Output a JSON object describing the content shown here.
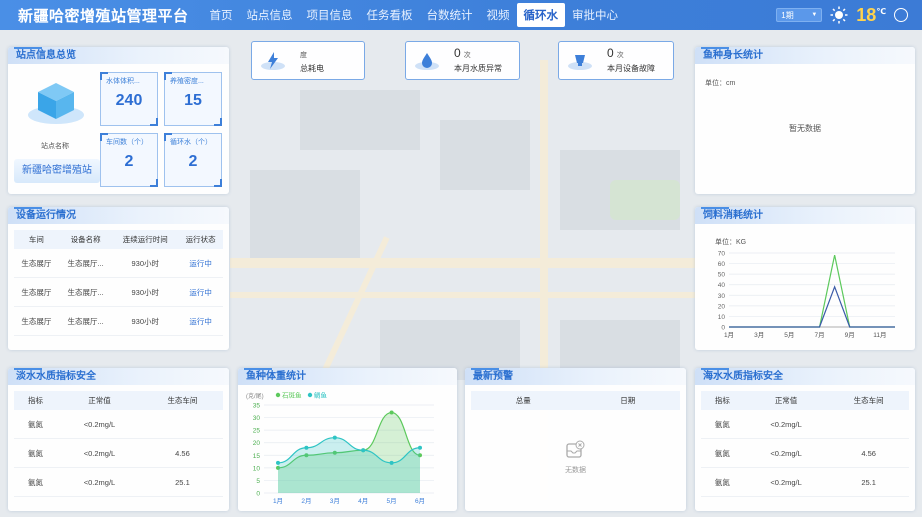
{
  "header": {
    "title": "新疆哈密增殖站管理平台",
    "nav": [
      "首页",
      "站点信息",
      "项目信息",
      "任务看板",
      "台数统计",
      "视频",
      "循环水",
      "审批中心"
    ],
    "active_index": 6,
    "period_select": "1期",
    "temperature": "18",
    "temp_unit": "℃"
  },
  "stats": [
    {
      "value": "",
      "unit": "度",
      "label": "总耗电",
      "icon": "power-icon"
    },
    {
      "value": "0",
      "unit": "次",
      "label": "本月水质异常",
      "icon": "water-quality-icon"
    },
    {
      "value": "0",
      "unit": "次",
      "label": "本月设备故障",
      "icon": "device-fault-icon"
    }
  ],
  "site": {
    "title": "站点信息总览",
    "name_label": "站点名称",
    "name": "新疆哈密增殖站",
    "cards": [
      {
        "label": "水体体积...",
        "value": "240"
      },
      {
        "label": "养殖密度...",
        "value": "15"
      },
      {
        "label": "车间数（个）",
        "value": "2"
      },
      {
        "label": "循环水（个）",
        "value": "2"
      }
    ]
  },
  "equipment": {
    "title": "设备运行情况",
    "columns": [
      "车间",
      "设备名称",
      "连续运行时间",
      "运行状态"
    ],
    "rows": [
      [
        "生态展厅",
        "生态展厅...",
        "930小时",
        "运行中"
      ],
      [
        "生态展厅",
        "生态展厅...",
        "930小时",
        "运行中"
      ],
      [
        "生态展厅",
        "生态展厅...",
        "930小时",
        "运行中"
      ]
    ]
  },
  "fish_length": {
    "title": "鱼种身长统计",
    "unit_label": "单位：cm",
    "empty_text": "暂无数据"
  },
  "feed": {
    "title": "饲料消耗统计",
    "unit_label": "单位：KG"
  },
  "fresh_water": {
    "title": "淡水水质指标安全",
    "columns": [
      "指标",
      "正常值",
      "生态车间"
    ],
    "rows": [
      [
        "氨氮",
        "<0.2mg/L",
        ""
      ],
      [
        "氨氮",
        "<0.2mg/L",
        "4.56"
      ],
      [
        "氨氮",
        "<0.2mg/L",
        "25.1"
      ]
    ]
  },
  "fish_weight": {
    "title": "鱼种体重统计"
  },
  "warning": {
    "title": "最新预警",
    "columns": [
      "总量",
      "日期"
    ],
    "empty_text": "无数据"
  },
  "sea_water": {
    "title": "海水水质指标安全",
    "columns": [
      "指标",
      "正常值",
      "生态车间"
    ],
    "rows": [
      [
        "氨氮",
        "<0.2mg/L",
        ""
      ],
      [
        "氨氮",
        "<0.2mg/L",
        "4.56"
      ],
      [
        "氨氮",
        "<0.2mg/L",
        "25.1"
      ]
    ]
  },
  "colors": {
    "accent": "#3d7fd9",
    "green": "#5cc95c",
    "teal": "#2ec4c4",
    "navy": "#3a5aa8"
  },
  "chart_data": [
    {
      "type": "line",
      "title": "饲料消耗统计",
      "ylabel": "单位：KG",
      "x": [
        "1月",
        "2月",
        "3月",
        "4月",
        "5月",
        "6月",
        "7月",
        "8月",
        "9月",
        "10月",
        "11月",
        "12月"
      ],
      "xticks": [
        "1月",
        "3月",
        "5月",
        "7月",
        "9月",
        "11月"
      ],
      "ylim": [
        0,
        70
      ],
      "yticks": [
        0,
        10,
        20,
        30,
        40,
        50,
        60,
        70
      ],
      "series": [
        {
          "values": [
            0,
            0,
            0,
            0,
            0,
            0,
            0,
            68,
            0,
            0,
            0,
            0
          ],
          "color": "#5cc95c"
        },
        {
          "values": [
            0,
            0,
            0,
            0,
            0,
            0,
            0,
            38,
            0,
            0,
            0,
            0
          ],
          "color": "#3a5aa8"
        }
      ],
      "grid": true
    },
    {
      "type": "area",
      "title": "鱼种体重统计",
      "ylabel": "(克/尾)",
      "x": [
        "1月",
        "2月",
        "3月",
        "4月",
        "5月",
        "6月"
      ],
      "ylim": [
        0,
        35
      ],
      "yticks": [
        0,
        5,
        10,
        15,
        20,
        25,
        30,
        35
      ],
      "series": [
        {
          "name": "石斑鱼",
          "values": [
            10,
            15,
            16,
            17,
            32,
            15
          ],
          "color": "#5cc95c"
        },
        {
          "name": "鲷鱼",
          "values": [
            12,
            18,
            22,
            17,
            12,
            18
          ],
          "color": "#2ec4c4"
        }
      ],
      "legend": "top-left",
      "grid": true
    }
  ]
}
